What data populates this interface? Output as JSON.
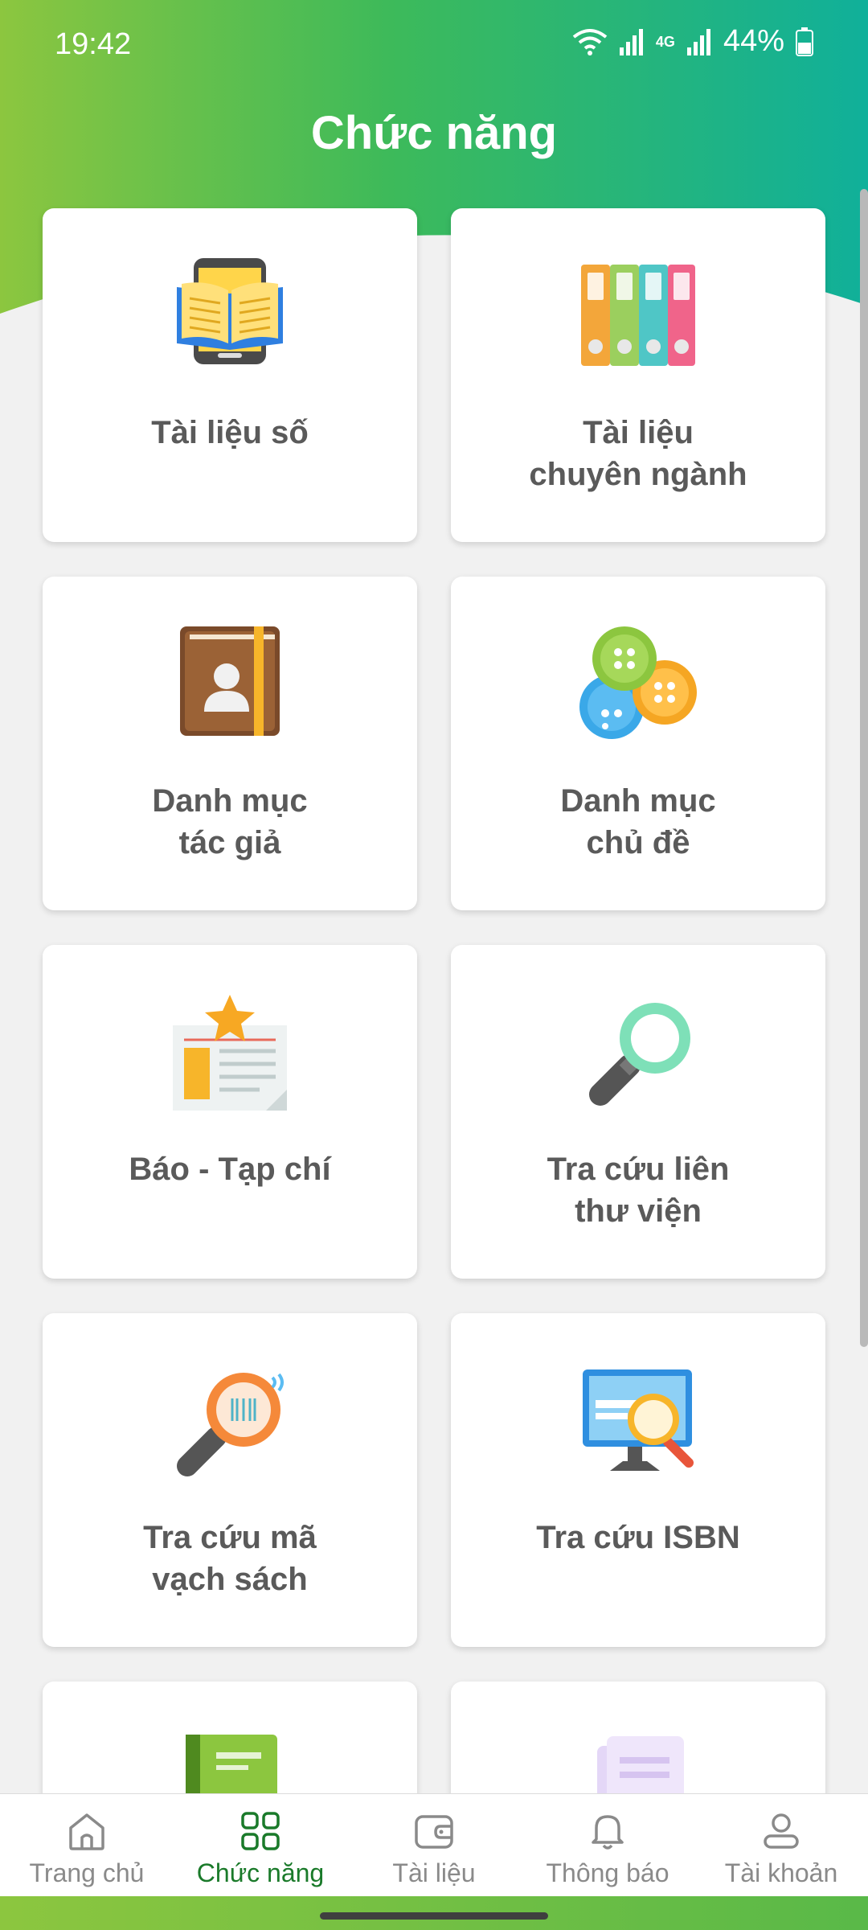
{
  "status": {
    "time": "19:42",
    "network": "4G",
    "battery": "44%"
  },
  "page": {
    "title": "Chức năng"
  },
  "cards": [
    {
      "lines": [
        "Tài liệu số"
      ],
      "icon": "digital-book-icon"
    },
    {
      "lines": [
        "Tài liệu",
        "chuyên ngành"
      ],
      "icon": "binders-icon"
    },
    {
      "lines": [
        "Danh mục",
        "tác giả"
      ],
      "icon": "contact-book-icon"
    },
    {
      "lines": [
        "Danh mục",
        "chủ đề"
      ],
      "icon": "buttons-icon"
    },
    {
      "lines": [
        "Báo - Tạp chí"
      ],
      "icon": "newspaper-icon"
    },
    {
      "lines": [
        "Tra cứu liên",
        "thư viện"
      ],
      "icon": "magnifier-icon"
    },
    {
      "lines": [
        "Tra cứu mã",
        "vạch sách"
      ],
      "icon": "barcode-search-icon"
    },
    {
      "lines": [
        "Tra cứu ISBN"
      ],
      "icon": "monitor-search-icon"
    },
    {
      "lines": [
        ""
      ],
      "icon": "green-book-icon"
    },
    {
      "lines": [
        ""
      ],
      "icon": "document-icon"
    }
  ],
  "nav": [
    {
      "label": "Trang chủ",
      "icon": "home-icon",
      "active": false
    },
    {
      "label": "Chức năng",
      "icon": "grid-icon",
      "active": true
    },
    {
      "label": "Tài liệu",
      "icon": "wallet-icon",
      "active": false
    },
    {
      "label": "Thông báo",
      "icon": "bell-icon",
      "active": false
    },
    {
      "label": "Tài khoản",
      "icon": "user-icon",
      "active": false
    }
  ],
  "colors": {
    "accent": "#1a7a2a",
    "header_start": "#8cc63f",
    "header_end": "#10b09a",
    "label": "#5a5a5a"
  }
}
